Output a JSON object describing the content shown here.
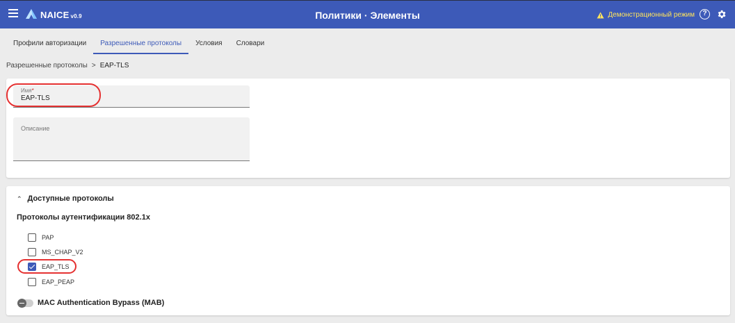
{
  "header": {
    "logo_text": "NAICE",
    "version": "v0.9",
    "title": "Политики · Элементы",
    "demo_mode": "Демонстрационный режим",
    "help_glyph": "?",
    "colors": {
      "bar": "#3d5ab8",
      "demo_text": "#ffe45c",
      "annotation": "#e53131"
    }
  },
  "tabs": [
    {
      "label": "Профили авторизации",
      "active": false
    },
    {
      "label": "Разрешенные протоколы",
      "active": true
    },
    {
      "label": "Условия",
      "active": false
    },
    {
      "label": "Словари",
      "active": false
    }
  ],
  "breadcrumb": {
    "parent": "Разрешенные протоколы",
    "separator": ">",
    "current": "EAP-TLS"
  },
  "form": {
    "name_label": "Имя",
    "name_required_mark": "*",
    "name_value": "EAP-TLS",
    "description_label": "Описание",
    "description_value": ""
  },
  "protocols": {
    "section_title": "Доступные протоколы",
    "subsection_title": "Протоколы аутентификации 802.1x",
    "items": [
      {
        "label": "PAP",
        "checked": false
      },
      {
        "label": "MS_CHAP_V2",
        "checked": false
      },
      {
        "label": "EAP_TLS",
        "checked": true
      },
      {
        "label": "EAP_PEAP",
        "checked": false
      }
    ],
    "mab_label": "MAC Authentication Bypass (MAB)",
    "mab_enabled": false
  }
}
